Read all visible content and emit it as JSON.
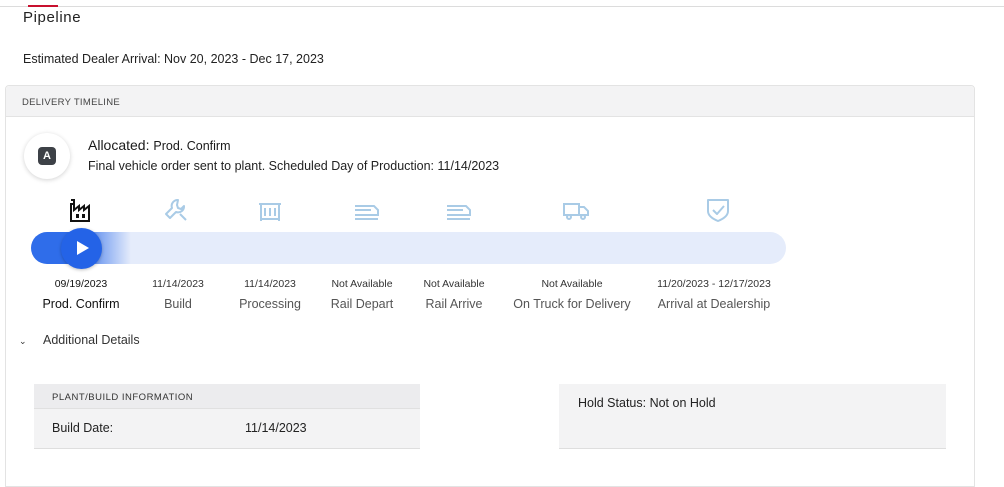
{
  "page": {
    "title": "Pipeline",
    "estimated_arrival": "Estimated Dealer Arrival: Nov 20, 2023 - Dec 17, 2023"
  },
  "timeline": {
    "header": "DELIVERY TIMELINE",
    "badge_letter": "A",
    "status_label": "Allocated:",
    "status_value": "Prod. Confirm",
    "description": "Final vehicle order sent to plant. Scheduled Day of Production: 11/14/2023",
    "progress_fraction": 0.08,
    "accent_color": "#2f6dea",
    "inactive_icon_color": "#a9cbe6",
    "stages": [
      {
        "icon": "factory-icon",
        "date": "09/19/2023",
        "label": "Prod. Confirm"
      },
      {
        "icon": "wrench-icon",
        "date": "11/14/2023",
        "label": "Build"
      },
      {
        "icon": "processing-icon",
        "date": "11/14/2023",
        "label": "Processing"
      },
      {
        "icon": "rail-depart-icon",
        "date": "Not Available",
        "label": "Rail Depart"
      },
      {
        "icon": "rail-arrive-icon",
        "date": "Not Available",
        "label": "Rail Arrive"
      },
      {
        "icon": "truck-icon",
        "date": "Not Available",
        "label": "On Truck for Delivery"
      },
      {
        "icon": "shield-check-icon",
        "date": "11/20/2023 - 12/17/2023",
        "label": "Arrival at Dealership"
      }
    ]
  },
  "details": {
    "toggle_label": "Additional Details",
    "plant_header": "PLANT/BUILD INFORMATION",
    "build_date_label": "Build Date:",
    "build_date_value": "11/14/2023",
    "hold_status": "Hold Status: Not on Hold"
  }
}
